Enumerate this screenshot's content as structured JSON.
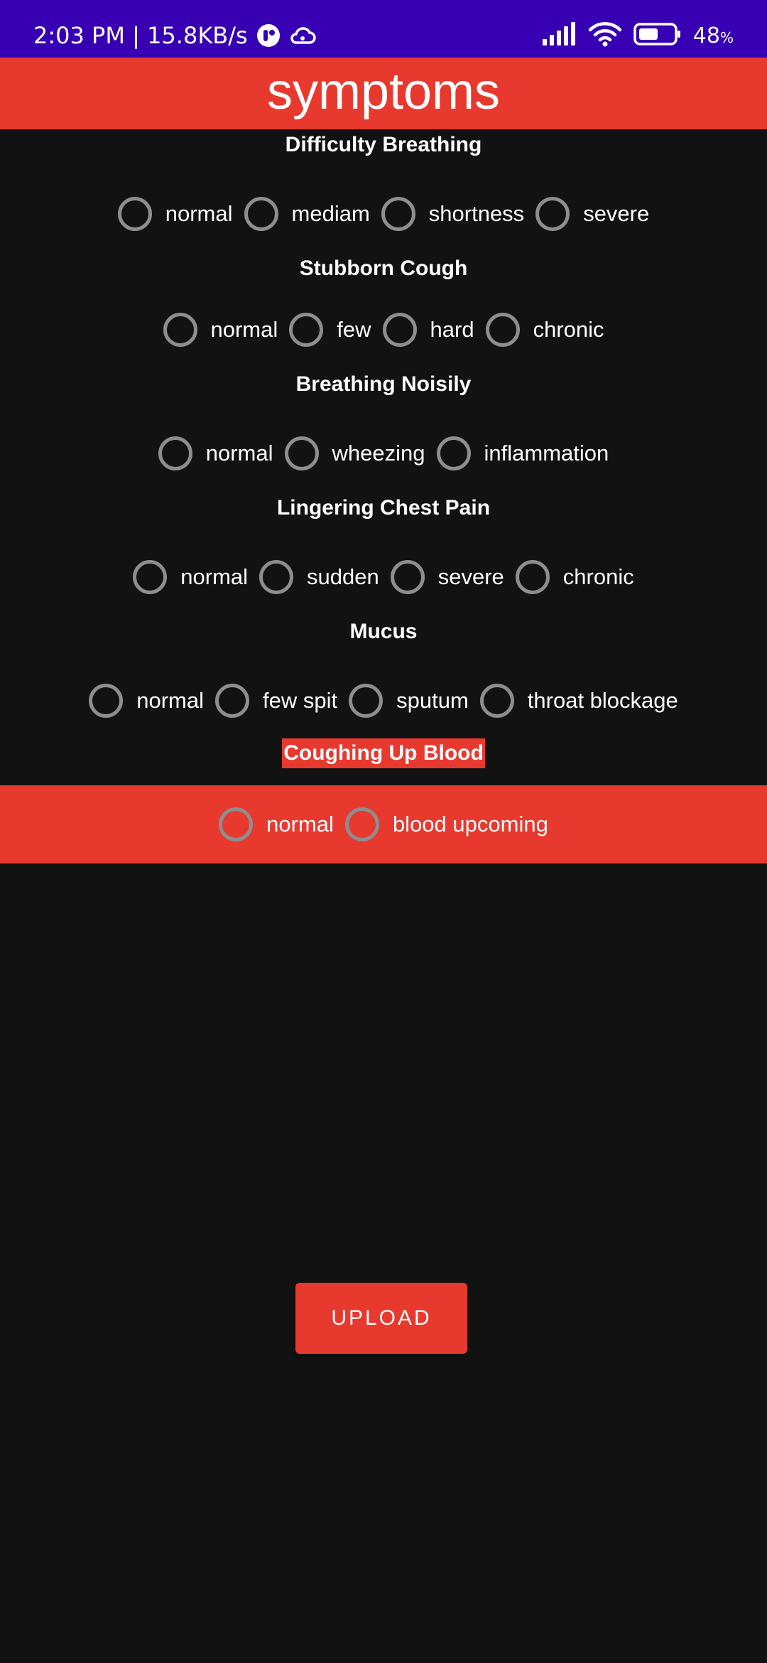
{
  "status_bar": {
    "time_speed": "2:03 PM | 15.8KB/s",
    "battery_level": "48",
    "battery_unit": "%",
    "icons": [
      "app-notification-icon",
      "cloud-icon",
      "signal-icon",
      "wifi-icon",
      "battery-icon"
    ]
  },
  "app_bar": {
    "title": "symptoms"
  },
  "sections": [
    {
      "title": "Difficulty Breathing",
      "options": [
        "normal",
        "mediam",
        "shortness",
        "severe"
      ]
    },
    {
      "title": "Stubborn Cough",
      "options": [
        "normal",
        "few",
        "hard",
        "chronic"
      ]
    },
    {
      "title": "Breathing Noisily",
      "options": [
        "normal",
        "wheezing",
        "inflammation"
      ]
    },
    {
      "title": "Lingering Chest Pain",
      "options": [
        "normal",
        "sudden",
        "severe",
        "chronic"
      ]
    },
    {
      "title": "Mucus",
      "options": [
        "normal",
        "few spit",
        "sputum",
        "throat blockage"
      ]
    },
    {
      "title": "Coughing Up Blood",
      "options": [
        "normal",
        "blood upcoming"
      ]
    }
  ],
  "upload_button": {
    "label": "UPLOAD"
  },
  "colors": {
    "status_bar": "#3700b3",
    "accent": "#e8392f",
    "background": "#121212",
    "radio_border": "#8e8e8e"
  }
}
